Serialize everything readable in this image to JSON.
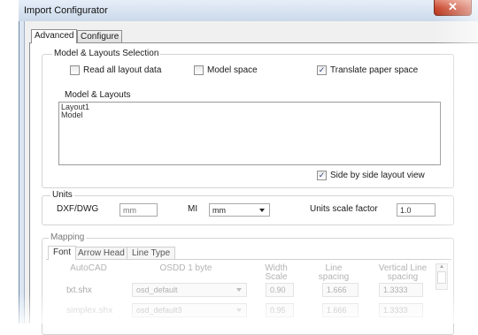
{
  "window": {
    "title": "Import Configurator",
    "close_glyph": "✕"
  },
  "tabs": [
    {
      "label": "Advanced",
      "active": true
    },
    {
      "label": "Configure",
      "active": false
    }
  ],
  "model_layouts_group": {
    "title": "Model & Layouts Selection",
    "checkboxes": [
      {
        "label": "Read all layout data",
        "checked": false
      },
      {
        "label": "Model space",
        "checked": false
      },
      {
        "label": "Translate paper space",
        "checked": true
      }
    ],
    "list_label": "Model & Layouts",
    "list_items": [
      "Layout1",
      "Model"
    ],
    "side_by_side": {
      "label": "Side by side layout view",
      "checked": true
    }
  },
  "units_group": {
    "title": "Units",
    "dxf_label": "DXF/DWG",
    "dxf_placeholder": "mm",
    "mi_label": "MI",
    "mi_value": "mm",
    "scale_label": "Units scale factor",
    "scale_value": "1.0"
  },
  "mapping_group": {
    "title": "Mapping",
    "subtabs": [
      {
        "label": "Font",
        "active": true
      },
      {
        "label": "Arrow Head",
        "active": false
      },
      {
        "label": "Line Type",
        "active": false
      }
    ],
    "columns": [
      "AutoCAD",
      "OSDD 1 byte",
      "Width Scale",
      "Line spacing",
      "Vertical Line spacing"
    ],
    "rows": [
      {
        "autocad": "txt.shx",
        "osdd": "osd_default",
        "width": "0.90",
        "line": "1.666",
        "vline": "1.3333"
      },
      {
        "autocad": "simplex.shx",
        "osdd": "osd_default3",
        "width": "0.95",
        "line": "1.666",
        "vline": "1.3333"
      }
    ]
  },
  "icons": {
    "check": "✓",
    "scroll_up": "▲"
  }
}
